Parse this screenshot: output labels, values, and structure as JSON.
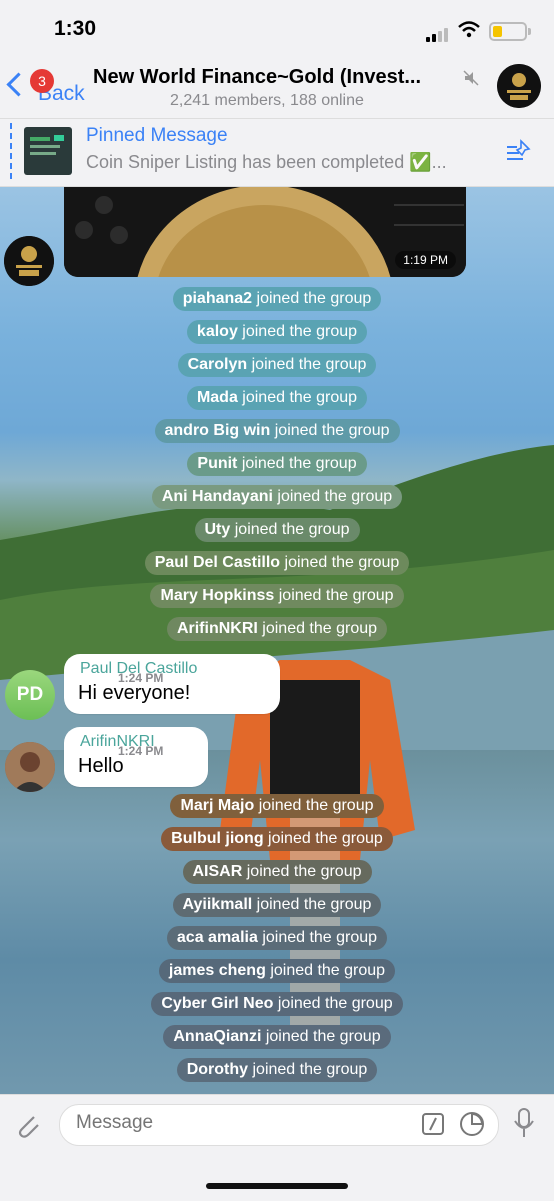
{
  "status_bar": {
    "time": "1:30"
  },
  "header": {
    "back_label": "Back",
    "unread_count": "3",
    "title": "New World Finance~Gold (Invest...",
    "subtitle": "2,241 members, 188 online"
  },
  "pinned": {
    "title": "Pinned Message",
    "text": "Coin Sniper Listing has been completed ✅..."
  },
  "media": {
    "time": "1:19 PM"
  },
  "joined_suffix": "joined the group",
  "joins_top": [
    {
      "name": "piahana2",
      "color": "#5aa3b3"
    },
    {
      "name": "kaloy",
      "color": "#5aa3b3"
    },
    {
      "name": "Carolyn",
      "color": "#5aa3b3"
    },
    {
      "name": "Mada",
      "color": "#5aa3b3"
    },
    {
      "name": "andro Big win",
      "color": "#5f9aa8"
    },
    {
      "name": "Punit",
      "color": "#6a9b8a"
    },
    {
      "name": "Ani Handayani",
      "color": "#7a9a80"
    },
    {
      "name": "Uty",
      "color": "#6a8a6a"
    },
    {
      "name": "Paul Del Castillo",
      "color": "#6d8a5c"
    },
    {
      "name": "Mary Hopkinss",
      "color": "#708a5f"
    },
    {
      "name": "ArifinNKRI",
      "color": "#6f8860"
    }
  ],
  "messages": [
    {
      "sender": "Paul Del Castillo",
      "text": "Hi everyone!",
      "time": "1:24 PM",
      "avatar_initials": "PD"
    },
    {
      "sender": "ArifinNKRI",
      "text": "Hello",
      "time": "1:24 PM"
    }
  ],
  "joins_bottom": [
    {
      "name": "Marj Majo",
      "color": "#80603c"
    },
    {
      "name": "Bulbul jiong",
      "color": "#8a5a3a"
    },
    {
      "name": "AISAR",
      "color": "#666a5e"
    },
    {
      "name": "Ayiikmall",
      "color": "#5e6b72"
    },
    {
      "name": "aca amalia",
      "color": "#5b6c78"
    },
    {
      "name": "james cheng",
      "color": "#56697a"
    },
    {
      "name": "Cyber Girl Neo",
      "color": "#58697a"
    },
    {
      "name": "AnnaQianzi",
      "color": "#5a6b7c"
    },
    {
      "name": "Dorothy",
      "color": "#5b6d7d"
    }
  ],
  "input": {
    "placeholder": "Message"
  }
}
